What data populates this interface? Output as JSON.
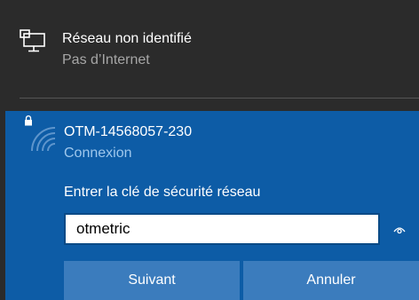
{
  "unidentified_network": {
    "name": "Réseau non identifié",
    "status": "Pas d’Internet",
    "icon": "monitor-network-icon"
  },
  "wifi_network": {
    "ssid": "OTM-14568057-230",
    "status": "Connexion",
    "icon": "wifi-secured-icon"
  },
  "security_key": {
    "label": "Entrer la clé de sécurité réseau",
    "value": "otmetric",
    "reveal_icon": "eye-icon"
  },
  "buttons": {
    "next_label": "Suivant",
    "cancel_label": "Annuler"
  },
  "colors": {
    "panel_dark": "#2b2b2b",
    "panel_blue": "#0d5ca6",
    "button_blue": "#3b7cbd"
  }
}
